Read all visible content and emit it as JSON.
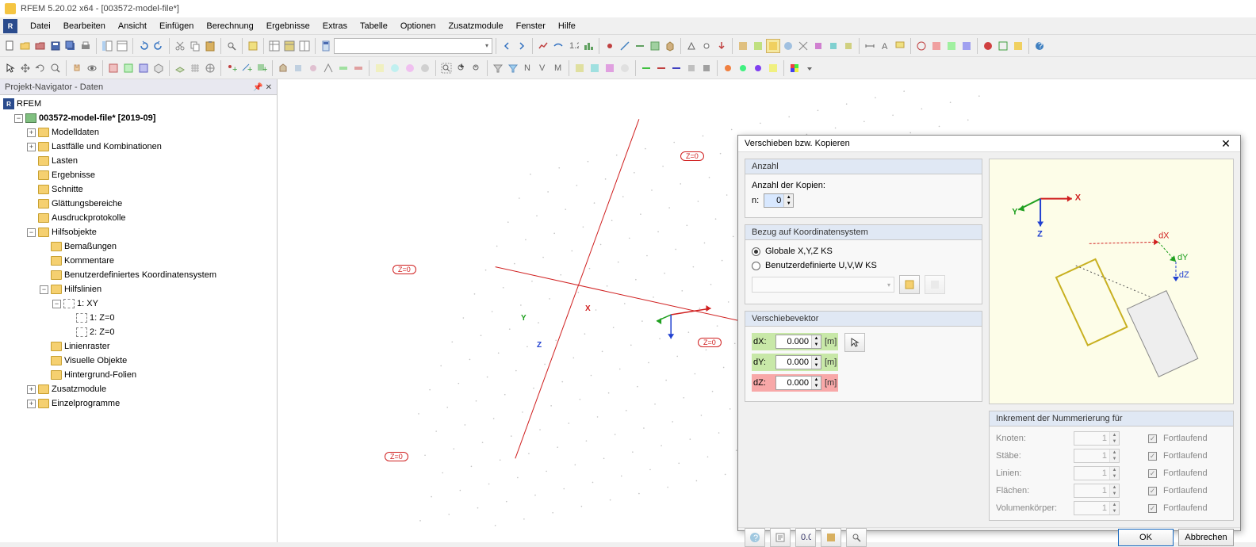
{
  "title": "RFEM 5.20.02 x64 - [003572-model-file*]",
  "menu": [
    "Datei",
    "Bearbeiten",
    "Ansicht",
    "Einfügen",
    "Berechnung",
    "Ergebnisse",
    "Extras",
    "Tabelle",
    "Optionen",
    "Zusatzmodule",
    "Fenster",
    "Hilfe"
  ],
  "navigator": {
    "title": "Projekt-Navigator - Daten",
    "root": "RFEM",
    "file": "003572-model-file* [2019-09]",
    "nodes": {
      "modelldaten": "Modelldaten",
      "lastfaelle": "Lastfälle und Kombinationen",
      "lasten": "Lasten",
      "ergebnisse": "Ergebnisse",
      "schnitte": "Schnitte",
      "glaettung": "Glättungsbereiche",
      "ausdruck": "Ausdruckprotokolle",
      "hilfsobjekte": "Hilfsobjekte",
      "bemassungen": "Bemaßungen",
      "kommentare": "Kommentare",
      "benutzer_ks": "Benutzerdefiniertes Koordinatensystem",
      "hilfslinien": "Hilfslinien",
      "xy": "1: XY",
      "z0_1": "1: Z=0",
      "z0_2": "2: Z=0",
      "linienraster": "Linienraster",
      "visuelle": "Visuelle Objekte",
      "hintergrund": "Hintergrund-Folien",
      "zusatzmodule": "Zusatzmodule",
      "einzelprogramme": "Einzelprogramme"
    }
  },
  "viewport": {
    "axis_x": "X",
    "axis_y": "Y",
    "axis_z": "Z",
    "tag": "Z=0"
  },
  "dialog": {
    "title": "Verschieben bzw. Kopieren",
    "anzahl_h": "Anzahl",
    "anzahl_lbl": "Anzahl der Kopien:",
    "n_lbl": "n:",
    "n_val": "0",
    "bezug_h": "Bezug auf Koordinatensystem",
    "radio_global": "Globale X,Y,Z KS",
    "radio_user": "Benutzerdefinierte U,V,W KS",
    "vektor_h": "Verschiebevektor",
    "dx_lbl": "dX:",
    "dy_lbl": "dY:",
    "dz_lbl": "dZ:",
    "dx_val": "0.000",
    "dy_val": "0.000",
    "dz_val": "0.000",
    "unit_m": "[m]",
    "inc_h": "Inkrement der Nummerierung für",
    "inc_knoten": "Knoten:",
    "inc_staebe": "Stäbe:",
    "inc_linien": "Linien:",
    "inc_flaechen": "Flächen:",
    "inc_volumen": "Volumenkörper:",
    "inc_val": "1",
    "inc_fort": "Fortlaufend",
    "preview": {
      "x": "X",
      "y": "Y",
      "z": "Z",
      "dx": "dX",
      "dy": "dY",
      "dz": "dZ"
    },
    "ok": "OK",
    "cancel": "Abbrechen"
  }
}
